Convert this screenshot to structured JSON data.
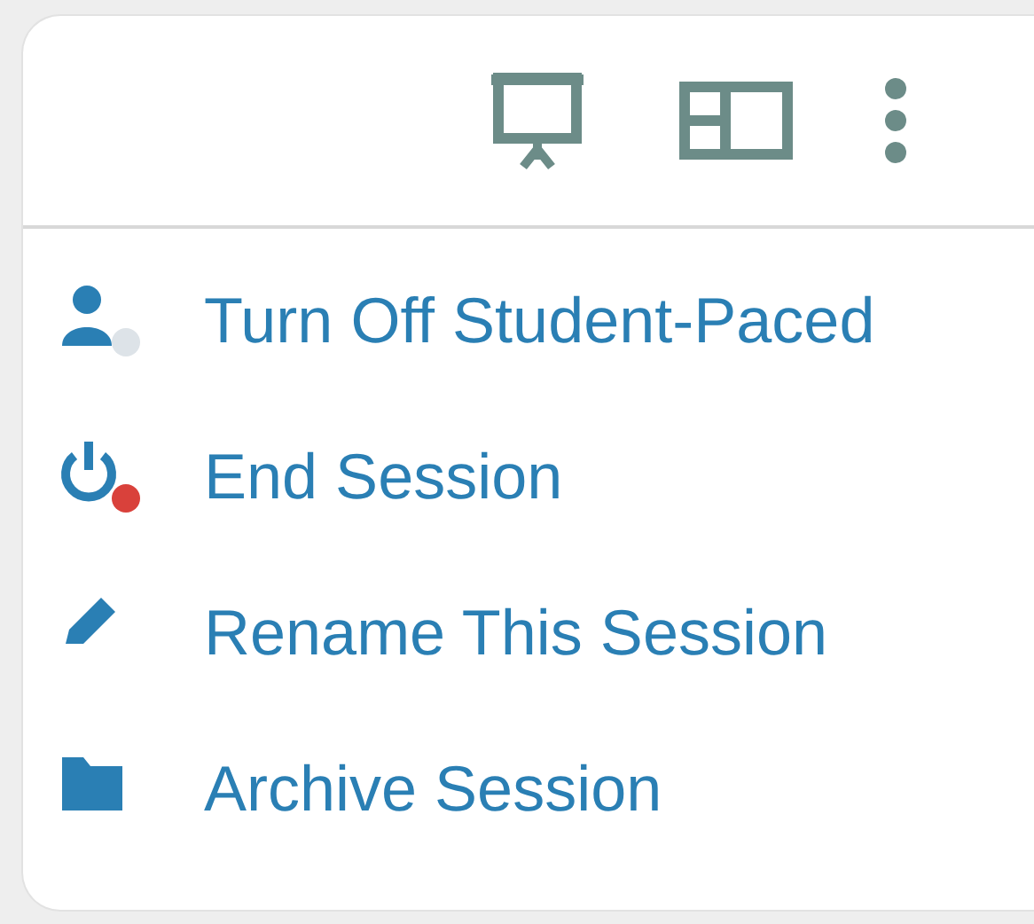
{
  "toolbar": {
    "icons": [
      {
        "kind": "presentation"
      },
      {
        "kind": "layout"
      },
      {
        "kind": "more"
      }
    ]
  },
  "menu": {
    "items": [
      {
        "kind": "student",
        "label": "Turn Off Student-Paced",
        "color": "#dde3e8"
      },
      {
        "kind": "power",
        "label": "End Session",
        "color": "#d9413b"
      },
      {
        "kind": "pencil",
        "label": "Rename This Session"
      },
      {
        "kind": "folder",
        "label": "Archive Session"
      }
    ]
  }
}
